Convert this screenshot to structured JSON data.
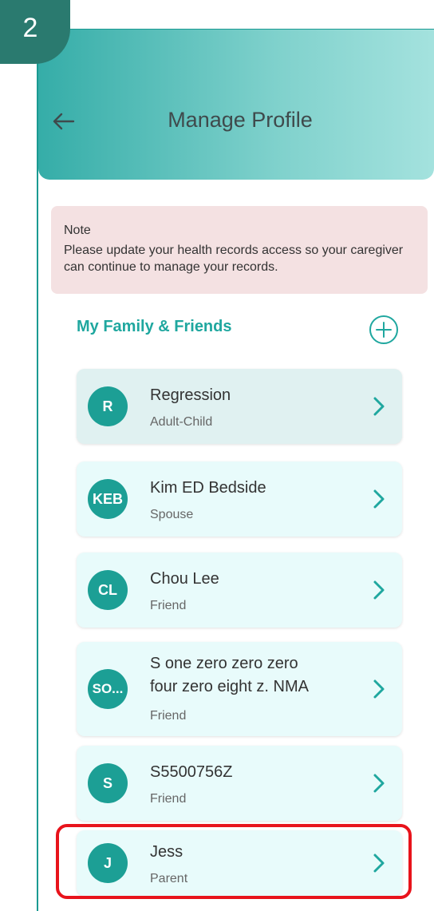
{
  "step": {
    "number": "2"
  },
  "header": {
    "title": "Manage Profile"
  },
  "note": {
    "title": "Note",
    "body": "Please update your health records access so your caregiver can continue to manage your records."
  },
  "section": {
    "title": "My Family & Friends"
  },
  "members": [
    {
      "initials": "R",
      "name": "Regression",
      "relationship": "Adult-Child"
    },
    {
      "initials": "KEB",
      "name": "Kim ED Bedside",
      "relationship": "Spouse"
    },
    {
      "initials": "CL",
      "name": "Chou Lee",
      "relationship": "Friend"
    },
    {
      "initials": "SO...",
      "name_line1": "S one zero zero zero",
      "name_line2": "four zero eight z. NMA",
      "relationship": "Friend"
    },
    {
      "initials": "S",
      "name": "S5500756Z",
      "relationship": "Friend"
    },
    {
      "initials": "J",
      "name": "Jess",
      "relationship": "Parent",
      "highlighted": true
    }
  ],
  "colors": {
    "accent": "#1fa79f",
    "avatar": "#1c9f95",
    "highlight": "#e8131b",
    "note_bg": "#f4e1e2",
    "card_bg": "#e8fbfb"
  },
  "icons": {
    "back": "arrow-left-icon",
    "add": "plus-circle-icon",
    "chevron": "chevron-right-icon"
  }
}
